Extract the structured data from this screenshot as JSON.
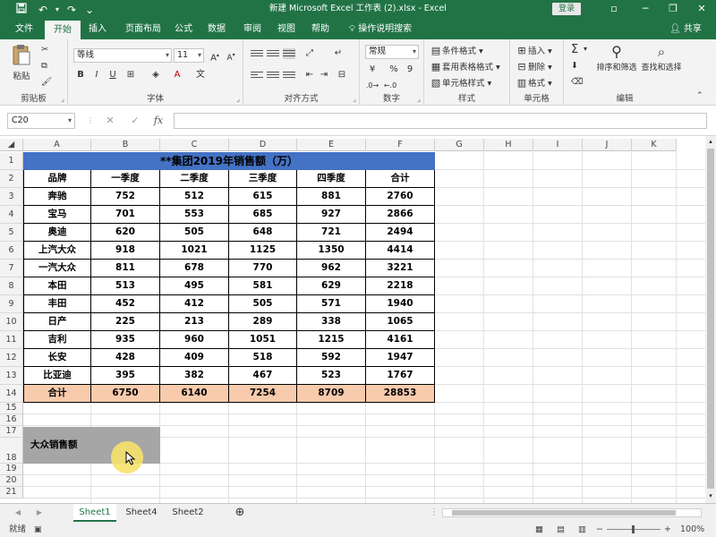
{
  "window": {
    "title": "新建 Microsoft Excel 工作表 (2).xlsx  -  Excel",
    "login": "登录",
    "controls": [
      "▫",
      "─",
      "❐",
      "✕"
    ]
  },
  "menu": {
    "tabs": [
      "文件",
      "开始",
      "插入",
      "页面布局",
      "公式",
      "数据",
      "审阅",
      "视图",
      "帮助"
    ],
    "active": "开始",
    "tell_me": "操作说明搜索",
    "share": "共享"
  },
  "ribbon": {
    "clipboard": {
      "paste": "粘贴",
      "label": "剪贴板"
    },
    "font": {
      "name": "等线",
      "size": "11",
      "bold": "B",
      "italic": "I",
      "underline": "U",
      "label": "字体"
    },
    "alignment": {
      "label": "对齐方式"
    },
    "number": {
      "format": "常规",
      "percent": "%",
      "comma": "9",
      "label": "数字"
    },
    "styles": {
      "conditional": "条件格式",
      "table": "套用表格格式",
      "cell": "单元格样式",
      "label": "样式"
    },
    "cells": {
      "insert": "插入",
      "delete": "删除",
      "format": "格式",
      "label": "单元格"
    },
    "editing": {
      "sum": "Σ",
      "sort": "排序和筛选",
      "find": "查找和选择",
      "label": "编辑"
    }
  },
  "formula_bar": {
    "name_box": "C20",
    "cancel": "✕",
    "enter": "✓",
    "fx": "fx",
    "content": ""
  },
  "sheet": {
    "columns": [
      "A",
      "B",
      "C",
      "D",
      "E",
      "F",
      "G",
      "H",
      "I",
      "J",
      "K"
    ],
    "rows": [
      "1",
      "2",
      "3",
      "4",
      "5",
      "6",
      "7",
      "8",
      "9",
      "10",
      "11",
      "12",
      "13",
      "14",
      "15",
      "16",
      "17",
      "18",
      "19",
      "20",
      "21"
    ],
    "title": "**集团2019年销售额（万）",
    "headers": [
      "品牌",
      "一季度",
      "二季度",
      "三季度",
      "四季度",
      "合计"
    ],
    "data": [
      [
        "奔驰",
        "752",
        "512",
        "615",
        "881",
        "2760"
      ],
      [
        "宝马",
        "701",
        "553",
        "685",
        "927",
        "2866"
      ],
      [
        "奥迪",
        "620",
        "505",
        "648",
        "721",
        "2494"
      ],
      [
        "上汽大众",
        "918",
        "1021",
        "1125",
        "1350",
        "4414"
      ],
      [
        "一汽大众",
        "811",
        "678",
        "770",
        "962",
        "3221"
      ],
      [
        "本田",
        "513",
        "495",
        "581",
        "629",
        "2218"
      ],
      [
        "丰田",
        "452",
        "412",
        "505",
        "571",
        "1940"
      ],
      [
        "日产",
        "225",
        "213",
        "289",
        "338",
        "1065"
      ],
      [
        "吉利",
        "935",
        "960",
        "1051",
        "1215",
        "4161"
      ],
      [
        "长安",
        "428",
        "409",
        "518",
        "592",
        "1947"
      ],
      [
        "比亚迪",
        "395",
        "382",
        "467",
        "523",
        "1767"
      ]
    ],
    "total": [
      "合计",
      "6750",
      "6140",
      "7254",
      "8709",
      "28853"
    ],
    "extra_label": "大众销售额",
    "colors": {
      "title_bg": "#4472c4",
      "total_bg": "#f8cbad",
      "label_bg": "#a6a6a6",
      "accent": "#217346",
      "cursor": "#f7e26b"
    }
  },
  "tabs": {
    "sheets": [
      "Sheet1",
      "Sheet4",
      "Sheet2"
    ],
    "active": "Sheet1"
  },
  "status": {
    "mode": "就绪",
    "zoom": "100%"
  }
}
